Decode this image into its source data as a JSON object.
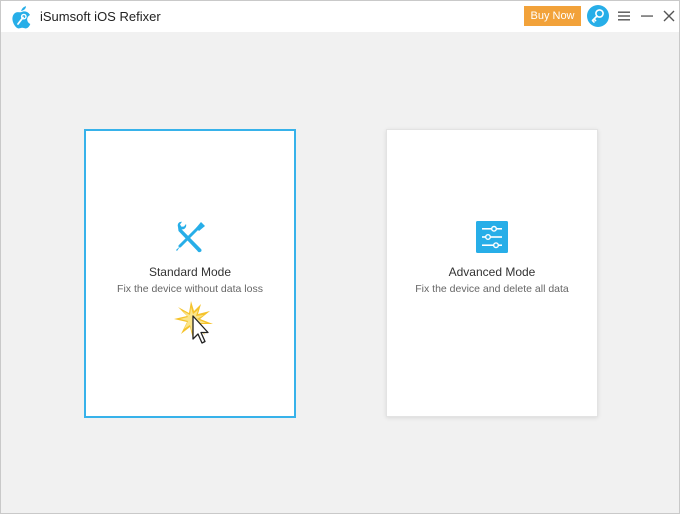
{
  "app": {
    "title": "iSumsoft iOS Refixer",
    "logo_icon": "apple-wrench-logo"
  },
  "titlebar": {
    "buy_label": "Buy Now",
    "buy_color": "#f2a23a",
    "key_icon": "key-icon",
    "key_color": "#27aee8",
    "menu_icon": "hamburger-menu-icon",
    "minimize_icon": "minimize-icon",
    "close_icon": "close-icon"
  },
  "modes": [
    {
      "title": "Standard Mode",
      "description": "Fix the device without data loss",
      "icon": "tools-icon",
      "selected": true,
      "accent": "#37b2ea"
    },
    {
      "title": "Advanced Mode",
      "description": "Fix the device and delete all data",
      "icon": "sliders-icon",
      "selected": false,
      "accent": "#27aee8"
    }
  ],
  "cursor": {
    "icon": "click-pointer-icon"
  }
}
